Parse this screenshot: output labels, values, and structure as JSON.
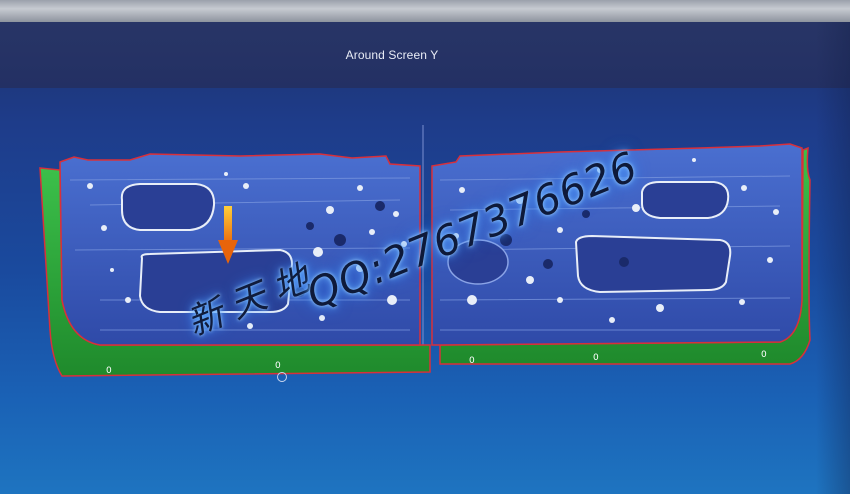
{
  "window": {
    "view_title": "Around Screen Y"
  },
  "watermark": {
    "chinese": "新天地",
    "qq": "QQ:2767376626",
    "glow_color": "#4da6ff"
  },
  "model": {
    "panel_fill": "#3a58b8",
    "flange_color": "#2fae3a",
    "outline_color": "#d9303a",
    "hole_color": "#e8eef8",
    "arrow_color": "#f08a10",
    "zero_labels": [
      "0",
      "0",
      "0",
      "0",
      "0"
    ]
  }
}
